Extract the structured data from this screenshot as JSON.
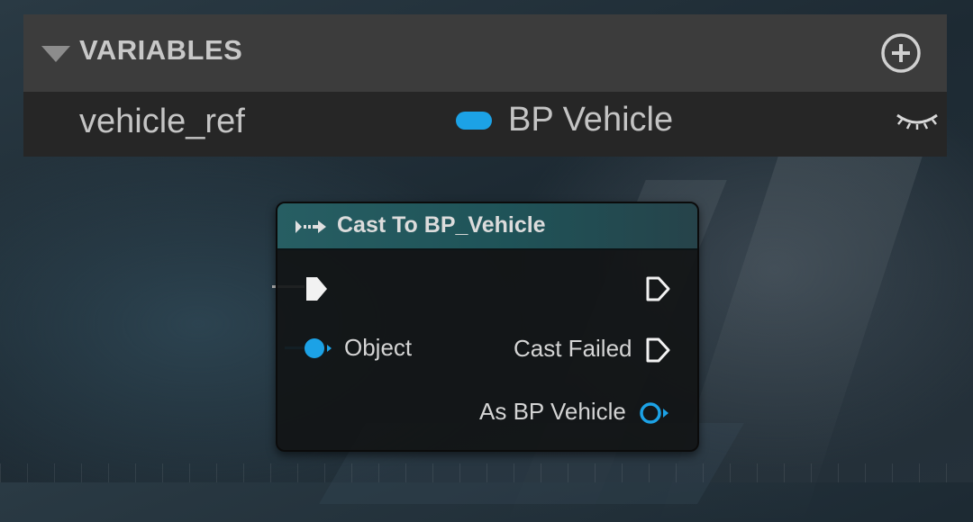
{
  "variables_panel": {
    "title": "VARIABLES",
    "add_icon": "add-circle-icon",
    "variable": {
      "name": "vehicle_ref",
      "type": "BP Vehicle",
      "type_color": "#1ca2e6",
      "visibility_icon": "eye-closed-icon"
    }
  },
  "node": {
    "title": "Cast To BP_Vehicle",
    "header_icon": "cast-arrow-icon",
    "header_color": "#275e63",
    "inputs": {
      "exec_icon": "exec-pin-icon",
      "object_label": "Object",
      "object_color": "#1ca2e6"
    },
    "outputs": {
      "exec_icon": "exec-pin-icon",
      "cast_failed_label": "Cast Failed",
      "as_label": "As BP Vehicle",
      "as_color": "#1ca2e6"
    }
  }
}
